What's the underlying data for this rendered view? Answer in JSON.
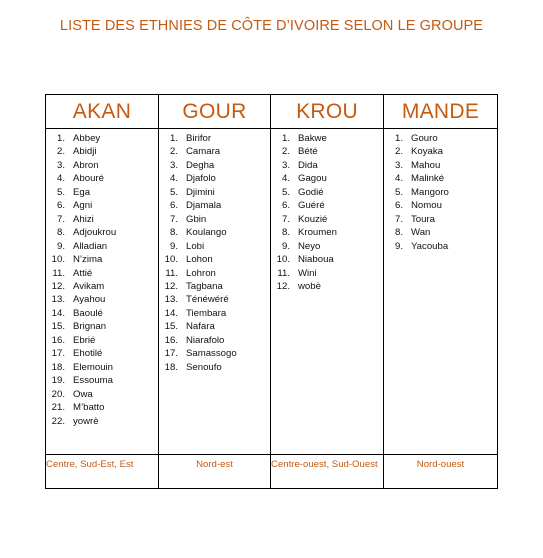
{
  "title": "LISTE DES ETHNIES DE CÔTE D’IVOIRE SELON LE GROUPE",
  "groups": [
    {
      "name": "AKAN",
      "items": [
        {
          "n": "1.",
          "label": "Abbey"
        },
        {
          "n": "2.",
          "label": "Abidji"
        },
        {
          "n": "3.",
          "label": "Abron"
        },
        {
          "n": "4.",
          "label": "Abouré"
        },
        {
          "n": "5.",
          "label": "Ega"
        },
        {
          "n": "6.",
          "label": "Agni"
        },
        {
          "n": "7.",
          "label": "Ahizi"
        },
        {
          "n": "8.",
          "label": "Adjoukrou"
        },
        {
          "n": "9.",
          "label": "Alladian"
        },
        {
          "n": "10.",
          "label": "N’zima"
        },
        {
          "n": "11.",
          "label": "Attié"
        },
        {
          "n": "12.",
          "label": "Avikam"
        },
        {
          "n": "13.",
          "label": "Ayahou"
        },
        {
          "n": "14.",
          "label": "Baoulé"
        },
        {
          "n": "15.",
          "label": "Brignan"
        },
        {
          "n": "16.",
          "label": "Ebrié"
        },
        {
          "n": "17.",
          "label": "Ehotilé"
        },
        {
          "n": "18.",
          "label": "Elemouin"
        },
        {
          "n": "19.",
          "label": "Essouma"
        },
        {
          "n": "20.",
          "label": "Owa"
        },
        {
          "n": "21.",
          "label": "M’batto"
        },
        {
          "n": "22.",
          "label": "yowrè"
        }
      ],
      "region": "Centre, Sud-Est, Est"
    },
    {
      "name": "GOUR",
      "items": [
        {
          "n": "1.",
          "label": "Birifor"
        },
        {
          "n": "2.",
          "label": "Camara"
        },
        {
          "n": "3.",
          "label": "Degha"
        },
        {
          "n": "4.",
          "label": "Djafolo"
        },
        {
          "n": "5.",
          "label": "Djimini"
        },
        {
          "n": "6.",
          "label": "Djamala"
        },
        {
          "n": "7.",
          "label": "Gbin"
        },
        {
          "n": "8.",
          "label": "Koulango"
        },
        {
          "n": "9.",
          "label": "Lobi"
        },
        {
          "n": "10.",
          "label": "Lohon"
        },
        {
          "n": "11.",
          "label": "Lohron"
        },
        {
          "n": "12.",
          "label": "Tagbana"
        },
        {
          "n": "13.",
          "label": "Ténéwéré"
        },
        {
          "n": "14.",
          "label": "Tiembara"
        },
        {
          "n": "15.",
          "label": "Nafara"
        },
        {
          "n": "16.",
          "label": "Niarafolo"
        },
        {
          "n": "17.",
          "label": "Samassogo"
        },
        {
          "n": "18.",
          "label": "Senoufo"
        }
      ],
      "region": "Nord-est"
    },
    {
      "name": "KROU",
      "items": [
        {
          "n": "1.",
          "label": "Bakwe"
        },
        {
          "n": "2.",
          "label": "Bété"
        },
        {
          "n": "3.",
          "label": "Dida"
        },
        {
          "n": "4.",
          "label": "Gagou"
        },
        {
          "n": "5.",
          "label": "Godié"
        },
        {
          "n": "6.",
          "label": "Guéré"
        },
        {
          "n": "7.",
          "label": "Kouzié"
        },
        {
          "n": "8.",
          "label": "Kroumen"
        },
        {
          "n": "9.",
          "label": "Neyo"
        },
        {
          "n": "10.",
          "label": "Niaboua"
        },
        {
          "n": "11.",
          "label": "Wini"
        },
        {
          "n": "12.",
          "label": "wobè"
        }
      ],
      "region": "Centre-ouest, Sud-Ouest"
    },
    {
      "name": "MANDE",
      "items": [
        {
          "n": "1.",
          "label": "Gouro"
        },
        {
          "n": "2.",
          "label": "Koyaka"
        },
        {
          "n": "3.",
          "label": "Mahou"
        },
        {
          "n": "4.",
          "label": "Malinké"
        },
        {
          "n": "5.",
          "label": "Mangoro"
        },
        {
          "n": "6.",
          "label": "Nomou"
        },
        {
          "n": "7.",
          "label": "Toura"
        },
        {
          "n": "8.",
          "label": "Wan"
        },
        {
          "n": "9.",
          "label": "Yacouba"
        }
      ],
      "region": "Nord-ouest"
    }
  ]
}
